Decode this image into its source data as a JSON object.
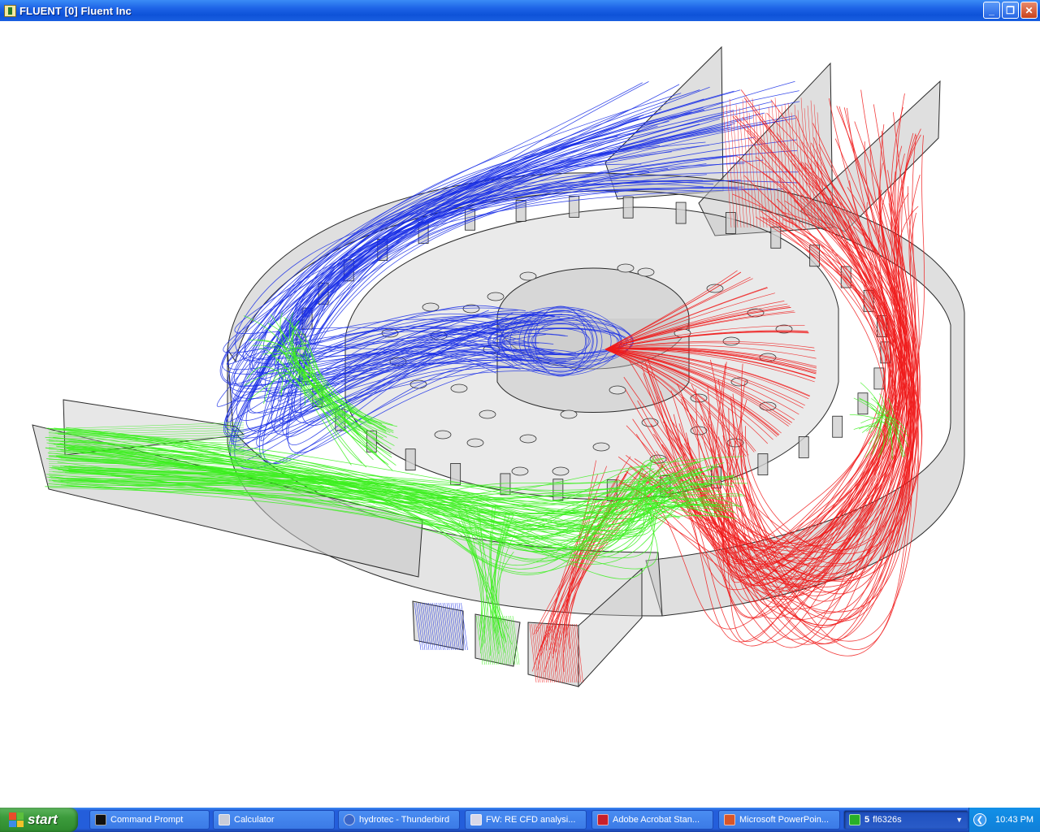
{
  "window": {
    "title": "FLUENT [0] Fluent Inc",
    "controls": {
      "minimize": "_",
      "maximize": "❐",
      "close": "✕"
    }
  },
  "viewport": {
    "content": "3d-streamline-render",
    "background": "#ffffff",
    "streamline_colors": {
      "blue": "#1a2fe6",
      "green": "#3cf01e",
      "red": "#f01a1a"
    },
    "geometry_color": "#b8b8b8"
  },
  "taskbar": {
    "start_label": "start",
    "buttons": [
      {
        "label": "Command Prompt",
        "icon": "cmd-icon",
        "color": "#111111"
      },
      {
        "label": "Calculator",
        "icon": "calculator-icon",
        "color": "#c8ccd8"
      },
      {
        "label": "hydrotec - Thunderbird",
        "icon": "thunderbird-icon",
        "color": "#3a66c8"
      },
      {
        "label": "FW: RE CFD analysi...",
        "icon": "mail-icon",
        "color": "#d8d8e8"
      },
      {
        "label": "Adobe Acrobat Stan...",
        "icon": "acrobat-icon",
        "color": "#c8202a"
      },
      {
        "label": "Microsoft PowerPoin...",
        "icon": "powerpoint-icon",
        "color": "#d8562a"
      },
      {
        "count": "5",
        "label": "fl6326s",
        "icon": "fluent-icon",
        "color": "#28b028"
      }
    ],
    "clock": "10:43 PM"
  }
}
